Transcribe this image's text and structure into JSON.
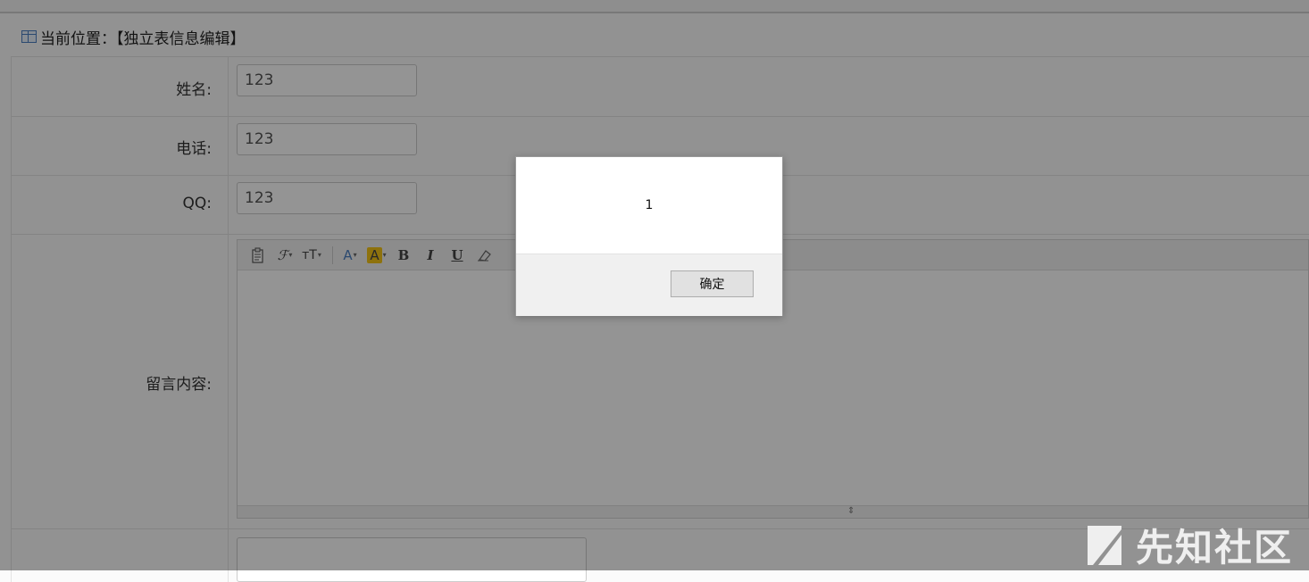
{
  "breadcrumb": {
    "text": "当前位置：【独立表信息编辑】"
  },
  "form": {
    "name_label": "姓名:",
    "name_value": "123",
    "phone_label": "电话:",
    "phone_value": "123",
    "qq_label": "QQ:",
    "qq_value": "123",
    "message_label": "留言内容:"
  },
  "editor_toolbar": {
    "items": [
      "paste-icon",
      "font-family-icon",
      "font-size-icon",
      "font-color-icon",
      "highlight-icon",
      "bold-icon",
      "italic-icon",
      "underline-icon",
      "eraser-icon"
    ],
    "bold": "B",
    "italic": "I",
    "underline": "U",
    "font_color": "A",
    "highlight": "A",
    "font_size": "тT",
    "font_family": "ℱ",
    "highlight_color": "#f5c518",
    "font_color_color": "#4a7fc1"
  },
  "dialog": {
    "message": "1",
    "ok_label": "确定"
  },
  "watermark": {
    "text": "先知社区"
  }
}
